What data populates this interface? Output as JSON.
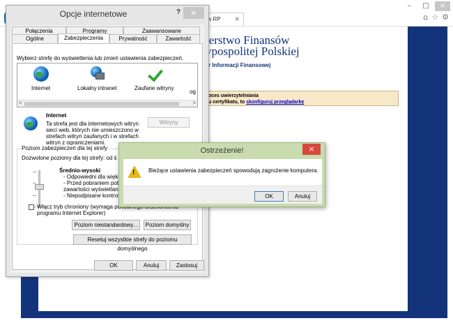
{
  "browser": {
    "tab_label": "ów RP",
    "tab_close": "×",
    "window_controls": {
      "minimize": "–",
      "maximize": "□",
      "close": "×"
    },
    "toolbar_icons": [
      "home-icon",
      "star-icon",
      "gear-icon"
    ],
    "toolbar_glyphs": {
      "home": "⌂",
      "favorites": "☆",
      "settings": "⚙"
    }
  },
  "site": {
    "title_line1": "terstwo Finansów",
    "title_line2": "ypospolitej Polskiej",
    "subtitle": "ktor Informacji Finansowej",
    "cert_line1": "proces uwierzytelniania",
    "cert_line2_prefix": "oru certyfikatu, to",
    "cert_link": "skonfiguruj przeglądarkę",
    "colors": {
      "navy": "#13337a",
      "cert_bg": "#f6e8c8"
    }
  },
  "options_dialog": {
    "title": "Opcje internetowe",
    "help": "?",
    "close": "×",
    "tabs_row1": [
      "Połączenia",
      "Programy",
      "Zaawansowane"
    ],
    "tabs_row2": [
      "Ogólne",
      "Zabezpieczenia",
      "Prywatność",
      "Zawartość"
    ],
    "active_tab": "Zabezpieczenia",
    "zone_prompt": "Wybierz strefę do wyświetlenia lub zmień ustawienia zabezpieczeń.",
    "zones": [
      {
        "label": "Internet",
        "icon": "globe-icon"
      },
      {
        "label": "Lokalny intranet",
        "icon": "intranet-icon"
      },
      {
        "label": "Zaufane witryny",
        "icon": "checkmark-icon"
      }
    ],
    "zone_overflow": "og",
    "scroll_left": "<",
    "scroll_right": ">",
    "zone_desc_title": "Internet",
    "zone_desc_text": "Ta strefa jest dla internetowych witryn sieci web, których nie umieszczono w strefach witryn zaufanych i w strefach witryn z ograniczeniami.",
    "sites_button": "Witryny",
    "level_group_label": "Poziom zabezpieczeń dla tej strefy",
    "allowed_levels": "Dozwolone poziomy dla tej strefy: od ś",
    "level_name": "Średnio-wysoki",
    "level_bullets": [
      "- Odpowiedni dla większo",
      "- Przed pobraniem potencja",
      "zawartości wyświetlany jes",
      "- Niepodpisane kontrolki Ac"
    ],
    "protected_mode_label": "Włącz tryb chroniony (wymaga ponownego uruchomienia programu Internet Explorer)",
    "custom_level_button": "Poziom niestandardowy...",
    "default_level_button": "Poziom domyślny",
    "reset_button": "Resetuj wszystkie strefy do poziomu domyślnego",
    "ok_button": "OK",
    "cancel_button": "Anuluj",
    "apply_button": "Zastosuj"
  },
  "warning_dialog": {
    "title": "Ostrzeżenie!",
    "close": "×",
    "icon": "warning-icon",
    "icon_mark": "!",
    "message": "Bieżące ustawienia zabezpieczeń spowodują zagrożenie komputera.",
    "ok_button": "OK",
    "cancel_button": "Anuluj",
    "colors": {
      "frame": "#c9dcaf",
      "close": "#d64a3b"
    }
  }
}
